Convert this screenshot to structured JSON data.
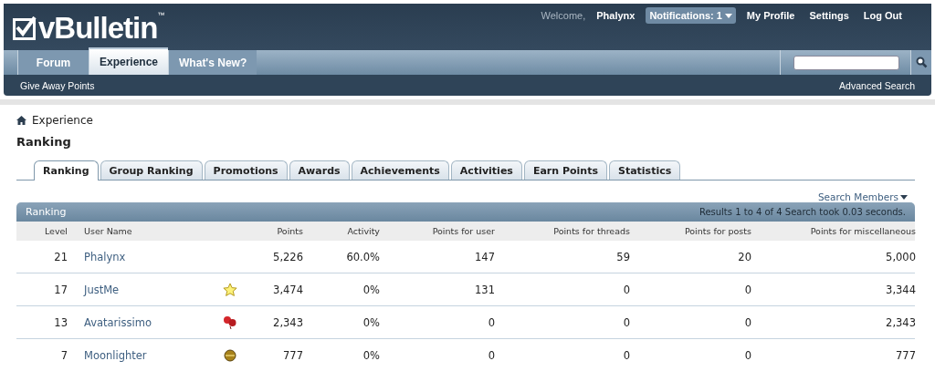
{
  "logo": {
    "name": "vBulletin",
    "mark": "™"
  },
  "user_bar": {
    "welcome": "Welcome,",
    "username": "Phalynx",
    "notifications": "Notifications: 1",
    "links": [
      "My Profile",
      "Settings",
      "Log Out"
    ]
  },
  "nav_tabs": [
    {
      "label": "Forum",
      "selected": false
    },
    {
      "label": "Experience",
      "selected": true
    },
    {
      "label": "What's New?",
      "selected": false
    }
  ],
  "sub_nav": {
    "left": "Give Away Points",
    "right": "Advanced Search"
  },
  "breadcrumb": "Experience",
  "page_title": "Ranking",
  "tabs": [
    {
      "label": "Ranking",
      "selected": true
    },
    {
      "label": "Group Ranking",
      "selected": false
    },
    {
      "label": "Promotions",
      "selected": false
    },
    {
      "label": "Awards",
      "selected": false
    },
    {
      "label": "Achievements",
      "selected": false
    },
    {
      "label": "Activities",
      "selected": false
    },
    {
      "label": "Earn Points",
      "selected": false
    },
    {
      "label": "Statistics",
      "selected": false
    }
  ],
  "search_members": "Search Members",
  "table": {
    "title": "Ranking",
    "summary": "Results 1 to 4 of 4 Search took 0.03 seconds.",
    "columns": [
      "Level",
      "User Name",
      "",
      "Points",
      "Activity",
      "Points for user",
      "Points for threads",
      "Points for posts",
      "Points for miscellaneous"
    ],
    "rows": [
      {
        "level": "21",
        "name": "Phalynx",
        "kind": "none",
        "points": "5,226",
        "activity": "60.0%",
        "user": "147",
        "threads": "59",
        "posts": "20",
        "misc": "5,000"
      },
      {
        "level": "17",
        "name": "JustMe",
        "kind": "star",
        "points": "3,474",
        "activity": "0%",
        "user": "131",
        "threads": "0",
        "posts": "0",
        "misc": "3,344"
      },
      {
        "level": "13",
        "name": "Avatarissimo",
        "kind": "balloons",
        "points": "2,343",
        "activity": "0%",
        "user": "0",
        "threads": "0",
        "posts": "0",
        "misc": "2,343"
      },
      {
        "level": "7",
        "name": "Moonlighter",
        "kind": "ball",
        "points": "777",
        "activity": "0%",
        "user": "0",
        "threads": "0",
        "posts": "0",
        "misc": "777"
      }
    ]
  }
}
